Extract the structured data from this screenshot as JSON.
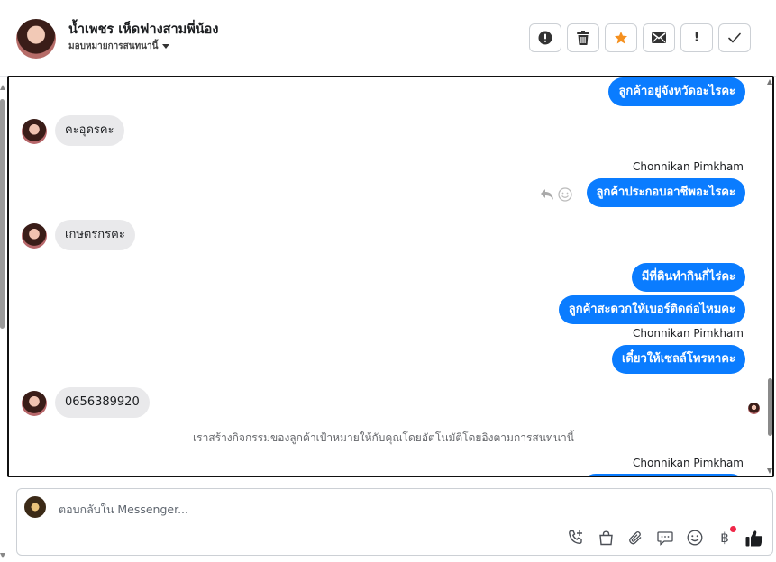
{
  "header": {
    "contact_name": "น้ำเพชร เห็ดฟางสามพี่น้อง",
    "assign_label": "มอบหมายการสนทนานี้",
    "toolbar": [
      {
        "name": "report-spam-button",
        "icon": "alert-circle-icon"
      },
      {
        "name": "delete-button",
        "icon": "trash-icon"
      },
      {
        "name": "star-button",
        "icon": "star-icon",
        "color": "#f5901e"
      },
      {
        "name": "mark-unread-button",
        "icon": "envelope-icon"
      },
      {
        "name": "follow-up-button",
        "icon": "exclamation-icon",
        "label": "!"
      },
      {
        "name": "mark-done-button",
        "icon": "check-icon"
      }
    ]
  },
  "conversation": {
    "messages": [
      {
        "direction": "out",
        "text": "ลูกค้าอยู่จังหวัดอะไรคะ"
      },
      {
        "direction": "in",
        "text": "คะอุดรคะ"
      },
      {
        "direction": "sender",
        "text": "Chonnikan Pimkham"
      },
      {
        "direction": "out",
        "text": "ลูกค้าประกอบอาชีพอะไรคะ"
      },
      {
        "direction": "in",
        "text": "เกษตรกรคะ"
      },
      {
        "direction": "out",
        "text": "มีที่ดินทำกินกี่ไร่คะ"
      },
      {
        "direction": "out",
        "text": "ลูกค้าสะดวกให้เบอร์ติดต่อไหมคะ"
      },
      {
        "direction": "sender",
        "text": "Chonnikan Pimkham"
      },
      {
        "direction": "out",
        "text": "เดี๋ยวให้เซลล์โทรหาคะ"
      },
      {
        "direction": "in",
        "text": "0656389920"
      },
      {
        "direction": "system",
        "text": "เราสร้างกิจกรรมของลูกค้าเป้าหมายให้กับคุณโดยอัตโนมัติโดยอิงตามการสนทนานี้"
      },
      {
        "direction": "sender",
        "text": "Chonnikan Pimkham"
      }
    ]
  },
  "composer": {
    "placeholder": "ตอบกลับใน Messenger...",
    "value": "",
    "tools": [
      "phone-add-icon",
      "shopping-bag-icon",
      "paperclip-icon",
      "chat-bubble-icon",
      "emoji-icon",
      "baht-icon",
      "like-icon"
    ],
    "baht_symbol": "฿"
  },
  "colors": {
    "accent": "#0a7cff",
    "incoming_bubble": "#e9e9eb",
    "star": "#f5901e",
    "notification_dot": "#f02849"
  }
}
